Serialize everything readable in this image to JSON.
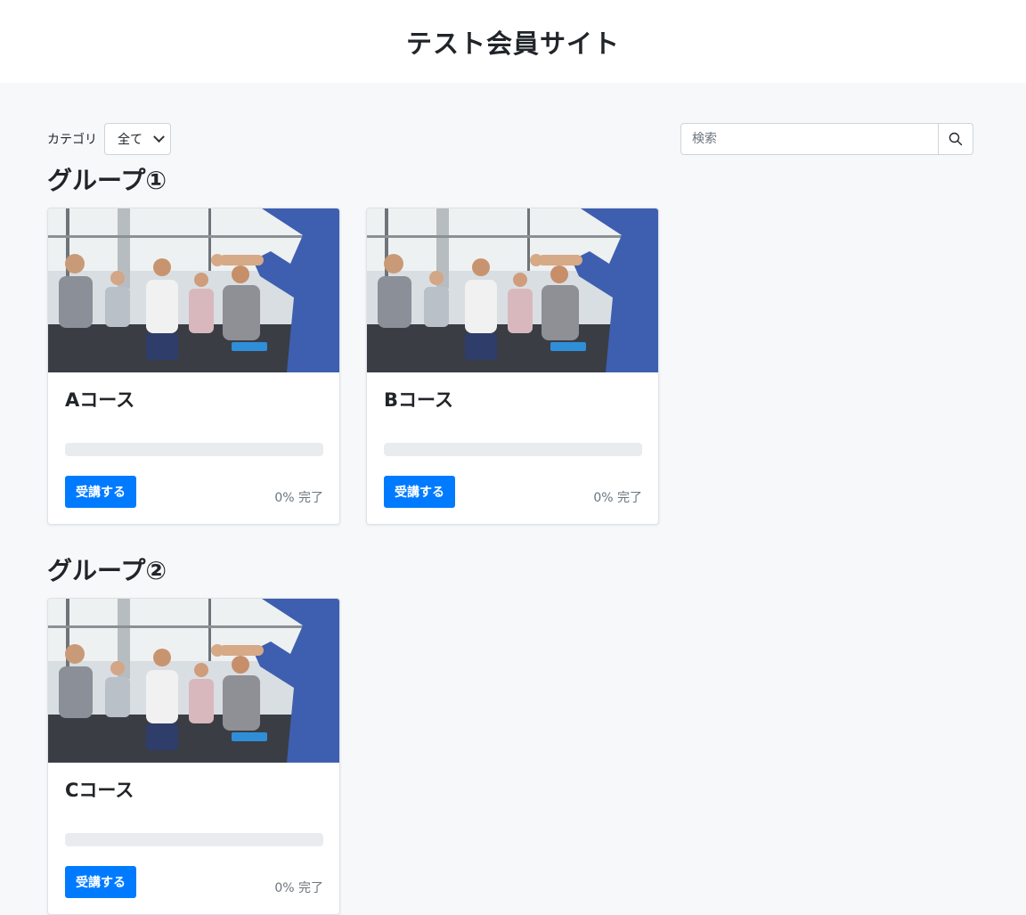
{
  "header": {
    "title": "テスト会員サイト"
  },
  "filter": {
    "category_label": "カテゴリ",
    "category_selected": "全て"
  },
  "search": {
    "placeholder": "検索"
  },
  "colors": {
    "accent": "#007bff",
    "page_bg": "#f7f8fa",
    "progress_track": "#e9ecef"
  },
  "groups": [
    {
      "heading": "グループ①",
      "courses": [
        {
          "title": "Aコース",
          "progress": 0,
          "button_label": "受講する",
          "completion_text": "0% 完了"
        },
        {
          "title": "Bコース",
          "progress": 0,
          "button_label": "受講する",
          "completion_text": "0% 完了"
        }
      ]
    },
    {
      "heading": "グループ②",
      "courses": [
        {
          "title": "Cコース",
          "progress": 0,
          "button_label": "受講する",
          "completion_text": "0% 完了"
        }
      ]
    }
  ]
}
